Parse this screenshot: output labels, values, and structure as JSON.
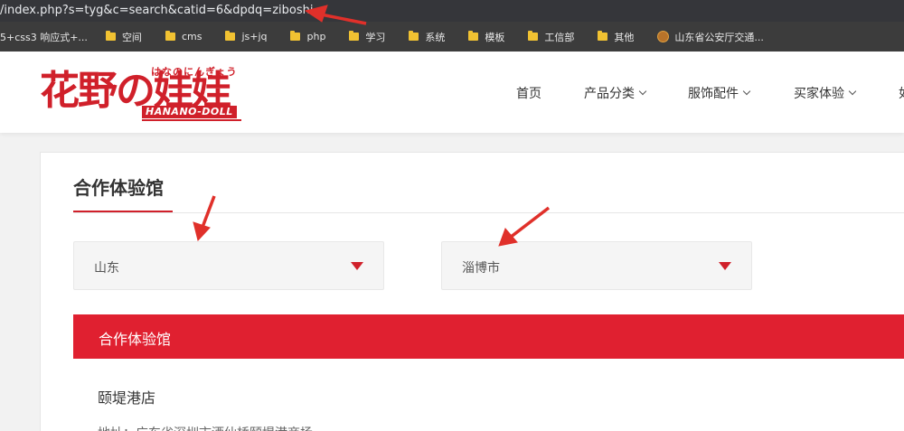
{
  "browser": {
    "url": "/index.php?s=tyg&c=search&catid=6&dpdq=ziboshi",
    "bookmarks": [
      {
        "label": "5+css3 响应式+...",
        "icon": "none"
      },
      {
        "label": "空间",
        "icon": "folder-icon"
      },
      {
        "label": "cms",
        "icon": "folder-icon"
      },
      {
        "label": "js+jq",
        "icon": "folder-icon"
      },
      {
        "label": "php",
        "icon": "folder-icon"
      },
      {
        "label": "学习",
        "icon": "folder-icon"
      },
      {
        "label": "系统",
        "icon": "folder-icon"
      },
      {
        "label": "模板",
        "icon": "folder-icon"
      },
      {
        "label": "工信部",
        "icon": "folder-icon"
      },
      {
        "label": "其他",
        "icon": "folder-icon"
      },
      {
        "label": "山东省公安厅交通...",
        "icon": "police-badge-icon"
      }
    ]
  },
  "header": {
    "logo": {
      "main": "花野の娃娃",
      "kana": "はなのにんぎょう",
      "english": "HANANO-DOLL"
    },
    "nav": [
      {
        "label": "首页",
        "has_dropdown": false
      },
      {
        "label": "产品分类",
        "has_dropdown": true
      },
      {
        "label": "服饰配件",
        "has_dropdown": true
      },
      {
        "label": "买家体验",
        "has_dropdown": true
      },
      {
        "label": "如",
        "has_dropdown": false
      }
    ]
  },
  "main": {
    "title": "合作体验馆",
    "province_select": {
      "value": "山东"
    },
    "city_select": {
      "value": "淄博市"
    },
    "section_bar": "合作体验馆",
    "store": {
      "name": "颐堤港店",
      "address": "地址：广东省深圳市酒仙桥颐堤港商场"
    }
  },
  "colors": {
    "brand_red": "#d0202a",
    "bar_red": "#e02030",
    "arrow_red": "#e0302a"
  }
}
